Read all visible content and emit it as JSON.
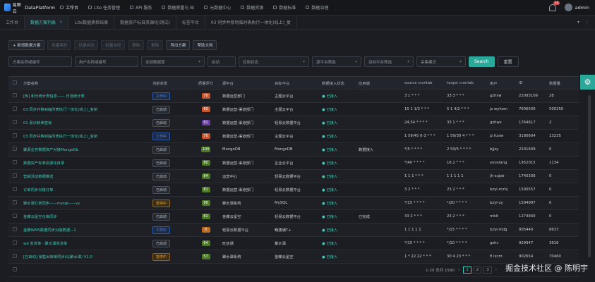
{
  "app": {
    "brand": "易图云",
    "name": "DataPlatform",
    "user": "admin",
    "notifications": "10"
  },
  "topnav": [
    "工作台",
    "Lite 任务管理",
    "API 服务",
    "数据质量与 BI",
    "元数据中心",
    "数据资源",
    "数据标准",
    "数据治理"
  ],
  "tabs": [
    {
      "label": "工作台",
      "active": false
    },
    {
      "label": "数据方案列表",
      "active": true
    },
    {
      "label": "Lite数据质检结果",
      "active": false
    },
    {
      "label": "数据资产标准资源化(测试)",
      "active": false
    },
    {
      "label": "标签平台",
      "active": false
    },
    {
      "label": "03 同步并移到临时表执行一体化(线上)_复",
      "active": false
    }
  ],
  "toolbar": [
    "新增数据方案",
    "批量审核",
    "批量启动",
    "批量关闭",
    "删除",
    "删除",
    "导出方案",
    "帮助文档"
  ],
  "filters": {
    "plan_name": "方案名称或编号",
    "owner": "用户名称或编号",
    "datasource": "全部数据源",
    "status": "启动",
    "app": "应用状态",
    "source": "源平台筛选",
    "target": "目标平台筛选",
    "mode": "采集模式",
    "search_btn": "Search",
    "reset_btn": "重置"
  },
  "columns": [
    "方案名称",
    "当前状态",
    "质量评分",
    "源平台",
    "目标平台",
    "数据接入状态",
    "应用端",
    "source crontab",
    "target crontab",
    "用户",
    "ID",
    "数据量"
  ],
  "rows": [
    {
      "name": "[BI] 积分统计表信息—— 日活统计表",
      "status": "工作中",
      "st": "run",
      "score": "70",
      "sc": "red",
      "src": "数据运营部门",
      "tgt": "主题云平台",
      "acc": "已接入",
      "app": "",
      "sc1": "3 1 * * *",
      "sc2": "33 3 * * *",
      "user": "gzhsw",
      "id": "22083106",
      "cnt": "28"
    },
    {
      "name": "03 同步并移到临时表执行一体化(线上)_复制",
      "status": "已启动",
      "st": "off",
      "score": "60",
      "sc": "red",
      "src": "数据运营-渠道部门",
      "tgt": "主题云平台",
      "acc": "已接入",
      "app": "",
      "sc1": "15 1 1/2 * * *",
      "sc2": "5 1 4/2 * * *",
      "user": "jz wyhom",
      "id": "7606500",
      "cnt": "500250"
    },
    {
      "name": "01 易诊断单查询",
      "status": "已启动",
      "st": "off",
      "score": "81",
      "sc": "pur",
      "src": "数据运营-渠道部门",
      "tgt": "轻易云数据平台",
      "acc": "已接入",
      "app": "",
      "sc1": "24,54 * * * *",
      "sc2": "33 1 * * *",
      "user": "gzhws",
      "id": "1764617",
      "cnt": "2"
    },
    {
      "name": "03 同步并移到临时表执行一体化(线上)_复制",
      "status": "工作中",
      "st": "run",
      "score": "70",
      "sc": "red",
      "src": "数据运营-渠道部门",
      "tgt": "主题云平台",
      "acc": "已接入",
      "app": "",
      "sc1": "1 59/45 0-3 * * *",
      "sc2": "1 59/30 4 * * *",
      "user": "jz hzsw",
      "id": "3180604",
      "cnt": "13235"
    },
    {
      "name": "聚源业务数据资产对接MongoDb",
      "status": "已启动",
      "st": "off",
      "score": "100",
      "sc": "grn",
      "src": "MongoDB",
      "tgt": "MongoDB",
      "acc": "已接入",
      "app": "数据接入",
      "sc1": "*/5 * * * *",
      "sc2": "2 59/5 * * * *",
      "user": "bjjzy",
      "id": "2201609",
      "cnt": "0"
    },
    {
      "name": "数据资产标准资源化目录",
      "status": "已启动",
      "st": "off",
      "score": "80",
      "sc": "grn",
      "src": "数据运营-渠道部门",
      "tgt": "企业云平台",
      "acc": "已接入",
      "app": "",
      "sc1": "*/40 * * * *",
      "sc2": "16 2 * * *",
      "user": "youxiang",
      "id": "1952015",
      "cnt": "1134"
    },
    {
      "name": "营销活动数据推送",
      "status": "已启动",
      "st": "off",
      "score": "84",
      "sc": "grn",
      "src": "运营中心",
      "tgt": "轻易云数据平台",
      "acc": "已接入",
      "app": "",
      "sc1": "1 1 1 * * *",
      "sc2": "1 1 1 1 1",
      "user": "jh-sujzb",
      "id": "1745336",
      "cnt": "0"
    },
    {
      "name": "订单同步对接订单",
      "status": "已启动",
      "st": "off",
      "score": "81",
      "sc": "grn",
      "src": "数据运营-渠道部门",
      "tgt": "轻易云数据平台",
      "acc": "已接入",
      "app": "",
      "sc1": "3 2 * * *",
      "sc2": "23 2 * * *",
      "user": "bzyl-mzhj",
      "id": "1590557",
      "cnt": "0"
    },
    {
      "name": "聚水潭订单同步——mysql——vs",
      "status": "暂停中",
      "st": "warn",
      "score": "90",
      "sc": "grn",
      "src": "聚水潭系统",
      "tgt": "MySQL",
      "acc": "已接入",
      "app": "",
      "sc1": "*/15 * * * *",
      "sc2": "*/20 * * * *",
      "user": "bzyl-zy",
      "id": "1594997",
      "cnt": "0"
    },
    {
      "name": "金蝶云星空仓库同步",
      "status": "已启动",
      "st": "off",
      "score": "81",
      "sc": "grn",
      "src": "金蝶云星空",
      "tgt": "轻易云数据平台",
      "acc": "已接入",
      "app": "已完成",
      "sc1": "33 2 * * *",
      "sc2": "23 2 * * *",
      "user": "mblt",
      "id": "1274840",
      "cnt": "0"
    },
    {
      "name": "金蝶WMS数据同步对接数据—1",
      "status": "工作中",
      "st": "run",
      "score": "0",
      "sc": "org",
      "src": "轻易云数据平台",
      "tgt": "畅捷通T+",
      "acc": "已接入",
      "app": "",
      "sc1": "1 1 1 1 1",
      "sc2": "*/15 * * * *",
      "user": "bzyl-mdg",
      "id": "805440",
      "cnt": "8637"
    },
    {
      "name": "wd 发货单 - 聚水潭发货单",
      "status": "已启动",
      "st": "off",
      "score": "64",
      "sc": "grn",
      "src": "旺店通",
      "tgt": "聚水潭",
      "acc": "已接入",
      "app": "",
      "sc1": "*/15 * * * *",
      "sc2": "*/10 * * * *",
      "user": "gzhc",
      "id": "929947",
      "cnt": "3616"
    },
    {
      "name": "[已启动] 销售出库单同步(以聚水潭) V1.0",
      "status": "暂停中",
      "st": "warn",
      "score": "57",
      "sc": "grn",
      "src": "聚水潭系统",
      "tgt": "金蝶云星空",
      "acc": "已接入",
      "app": "",
      "sc1": "1 * 22 22 * * *",
      "sc2": "30 4 23 * * *",
      "user": "fl lxcm",
      "id": "902654",
      "cnt": "70460"
    },
    {
      "name": "",
      "status": "",
      "st": "",
      "score": "",
      "sc": "",
      "src": "",
      "tgt": "",
      "acc": "",
      "app": "",
      "sc1": "",
      "sc2": "",
      "user": "",
      "id": "",
      "cnt": ""
    }
  ],
  "pager": {
    "summary": "1-20 总共 1590",
    "pages": [
      "1",
      "2",
      "3"
    ],
    "current": "1"
  },
  "watermark": "掘金技术社区 @ 陈明宇"
}
